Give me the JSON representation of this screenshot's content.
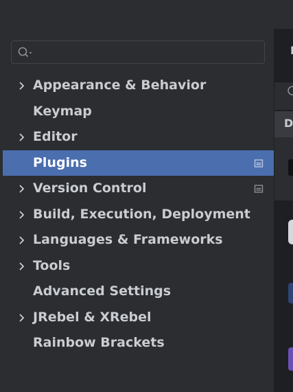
{
  "search": {
    "value": "",
    "placeholder": ""
  },
  "tree": {
    "items": [
      {
        "label": "Appearance & Behavior"
      },
      {
        "label": "Keymap"
      },
      {
        "label": "Editor"
      },
      {
        "label": "Plugins"
      },
      {
        "label": "Version Control"
      },
      {
        "label": "Build, Execution, Deployment"
      },
      {
        "label": "Languages & Frameworks"
      },
      {
        "label": "Tools"
      },
      {
        "label": "Advanced Settings"
      },
      {
        "label": "JRebel & XRebel"
      },
      {
        "label": "Rainbow Brackets"
      }
    ]
  },
  "right_panel": {
    "tab_letter_1": "I",
    "tab_letter_2": "D"
  },
  "colors": {
    "selection": "#4b6eaf",
    "sidebar_bg": "#2b2d30",
    "text": "#c9ccd1"
  }
}
